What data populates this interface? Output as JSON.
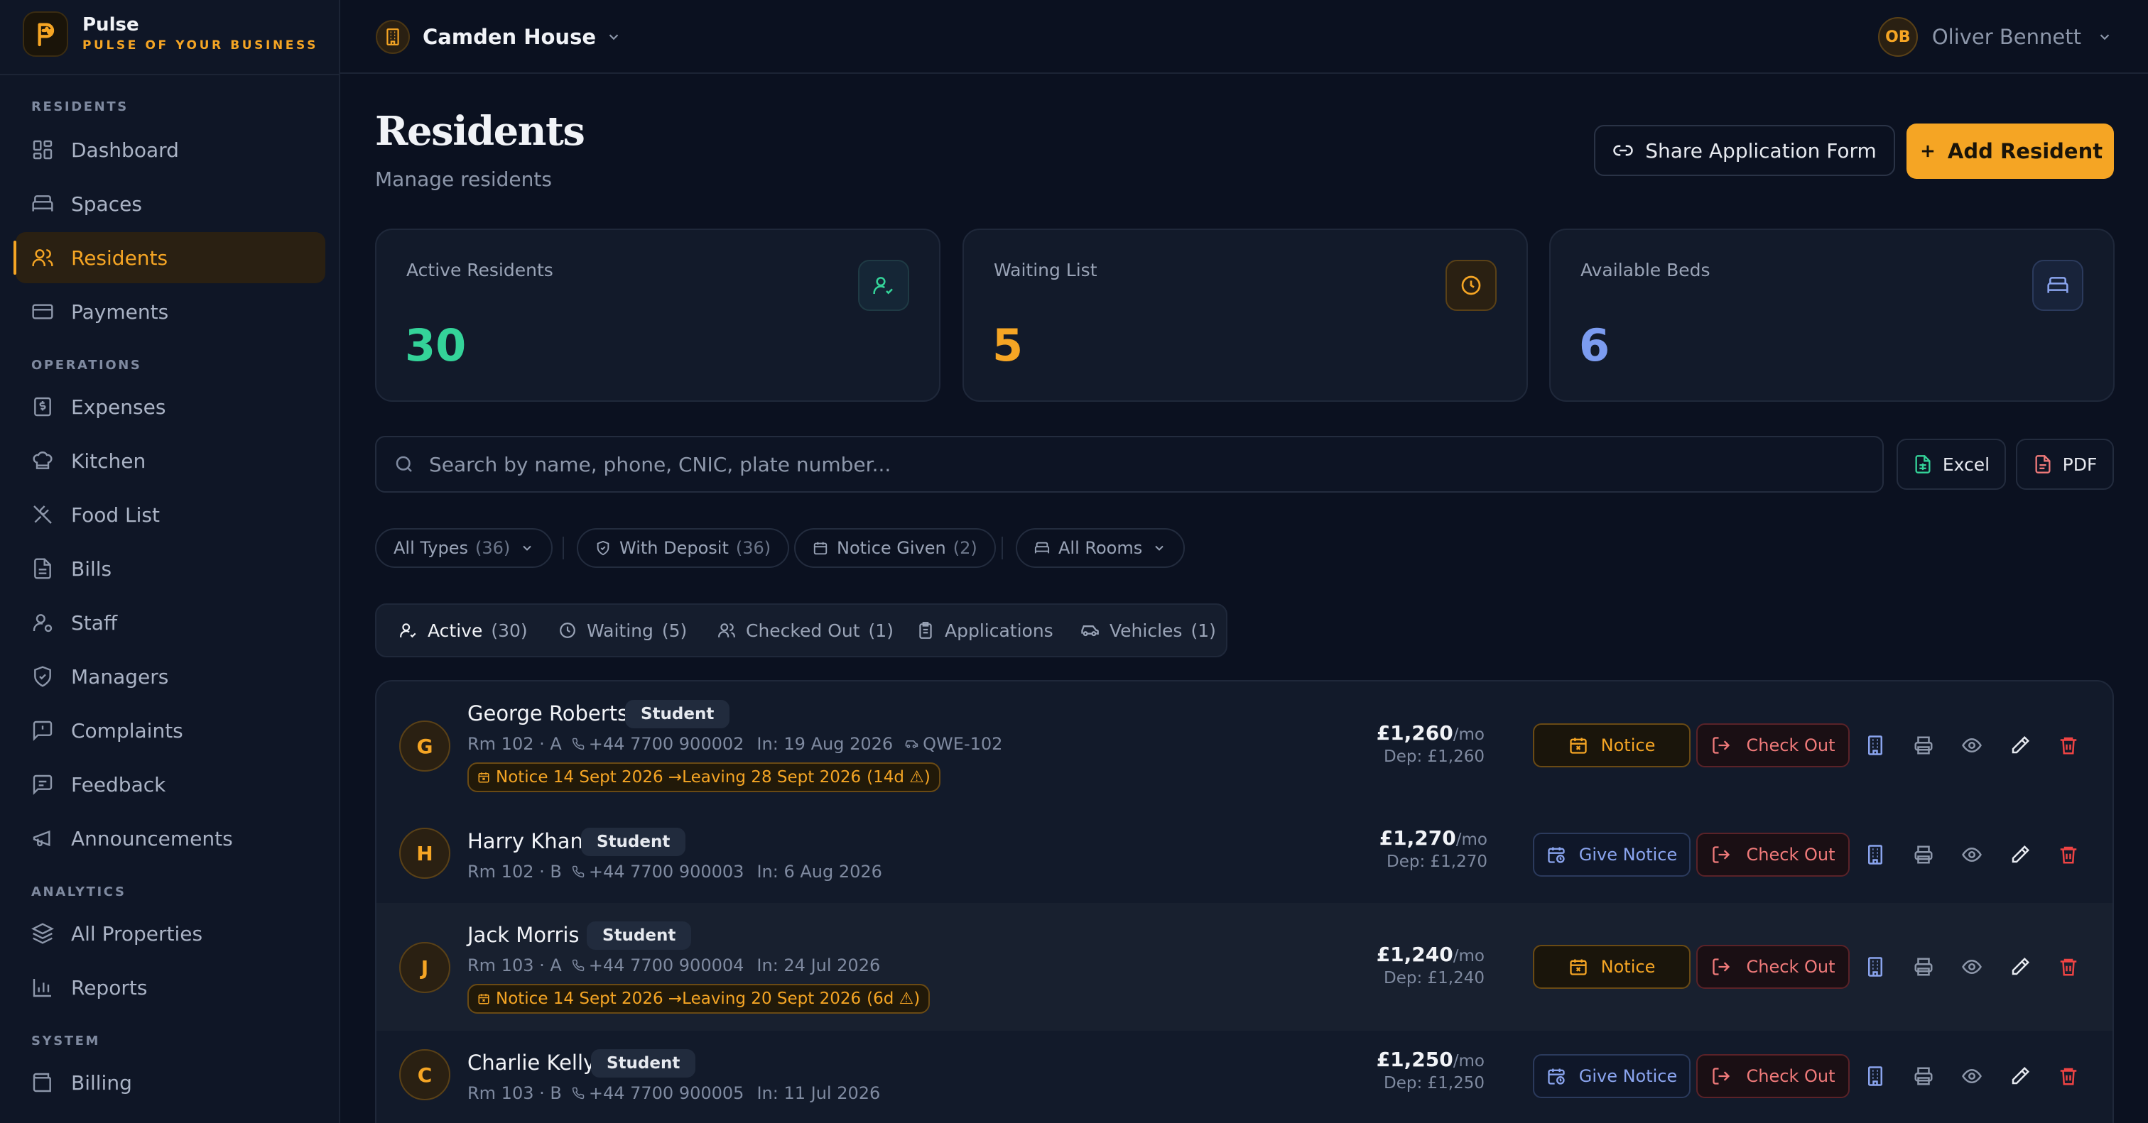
{
  "brand": {
    "name": "Pulse",
    "tagline": "PULSE OF YOUR BUSINESS"
  },
  "sidebar": {
    "sections": [
      {
        "title": "RESIDENTS",
        "items": [
          {
            "label": "Dashboard",
            "icon": "dashboard-icon"
          },
          {
            "label": "Spaces",
            "icon": "bed-icon"
          },
          {
            "label": "Residents",
            "icon": "users-icon",
            "active": true
          },
          {
            "label": "Payments",
            "icon": "card-icon"
          }
        ]
      },
      {
        "title": "OPERATIONS",
        "items": [
          {
            "label": "Expenses",
            "icon": "receipt-icon"
          },
          {
            "label": "Kitchen",
            "icon": "chef-hat-icon"
          },
          {
            "label": "Food List",
            "icon": "utensils-icon"
          },
          {
            "label": "Bills",
            "icon": "file-icon"
          },
          {
            "label": "Staff",
            "icon": "user-cog-icon"
          },
          {
            "label": "Managers",
            "icon": "shield-icon"
          },
          {
            "label": "Complaints",
            "icon": "alert-message-icon"
          },
          {
            "label": "Feedback",
            "icon": "message-icon"
          },
          {
            "label": "Announcements",
            "icon": "megaphone-icon"
          }
        ]
      },
      {
        "title": "ANALYTICS",
        "items": [
          {
            "label": "All Properties",
            "icon": "layers-icon"
          },
          {
            "label": "Reports",
            "icon": "bar-chart-icon"
          }
        ]
      },
      {
        "title": "SYSTEM",
        "items": [
          {
            "label": "Billing",
            "icon": "wallet-icon"
          }
        ]
      }
    ]
  },
  "topbar": {
    "property": "Camden House",
    "user_initials": "OB",
    "user_name": "Oliver Bennett"
  },
  "header": {
    "title": "Residents",
    "subtitle": "Manage residents",
    "share_label": "Share Application Form",
    "add_label": "Add Resident"
  },
  "stats": [
    {
      "label": "Active Residents",
      "value": "30",
      "color": "#34d399",
      "icon": "user-check-icon"
    },
    {
      "label": "Waiting List",
      "value": "5",
      "color": "#f5a524",
      "icon": "clock-icon"
    },
    {
      "label": "Available Beds",
      "value": "6",
      "color": "#7c9cf0",
      "icon": "bed-icon"
    }
  ],
  "search": {
    "placeholder": "Search by name, phone, CNIC, plate number..."
  },
  "exports": {
    "excel": "Excel",
    "pdf": "PDF"
  },
  "filters": [
    {
      "label": "All Types",
      "count": "(36)"
    },
    {
      "label": "With Deposit",
      "count": "(36)"
    },
    {
      "label": "Notice Given",
      "count": "(2)"
    },
    {
      "label": "All Rooms",
      "count": ""
    }
  ],
  "tabs": [
    {
      "label": "Active",
      "count": "(30)"
    },
    {
      "label": "Waiting",
      "count": "(5)"
    },
    {
      "label": "Checked Out",
      "count": "(1)"
    },
    {
      "label": "Applications",
      "count": ""
    },
    {
      "label": "Vehicles",
      "count": "(1)"
    }
  ],
  "residents": [
    {
      "initial": "G",
      "name": "George Roberts",
      "type": "Student",
      "room": "Rm 102 · A",
      "phone": "+44 7700 900002",
      "checkin": "In: 19 Aug 2026",
      "plate": "QWE-102",
      "notice": "Notice 14 Sept 2026 →Leaving 28 Sept 2026",
      "notice_days": "(14d ⚠)",
      "rent": "£1,260",
      "per": "/mo",
      "deposit": "Dep: £1,260",
      "notice_button": "Notice",
      "checkout_button": "Check Out"
    },
    {
      "initial": "H",
      "name": "Harry Khan",
      "type": "Student",
      "room": "Rm 102 · B",
      "phone": "+44 7700 900003",
      "checkin": "In: 6 Aug 2026",
      "plate": "",
      "notice": "",
      "notice_days": "",
      "rent": "£1,270",
      "per": "/mo",
      "deposit": "Dep: £1,270",
      "notice_button": "Give Notice",
      "checkout_button": "Check Out"
    },
    {
      "initial": "J",
      "name": "Jack Morris",
      "type": "Student",
      "room": "Rm 103 · A",
      "phone": "+44 7700 900004",
      "checkin": "In: 24 Jul 2026",
      "plate": "",
      "notice": "Notice 14 Sept 2026 →Leaving 20 Sept 2026",
      "notice_days": "(6d ⚠)",
      "rent": "£1,240",
      "per": "/mo",
      "deposit": "Dep: £1,240",
      "notice_button": "Notice",
      "checkout_button": "Check Out"
    },
    {
      "initial": "C",
      "name": "Charlie Kelly",
      "type": "Student",
      "room": "Rm 103 · B",
      "phone": "+44 7700 900005",
      "checkin": "In: 11 Jul 2026",
      "plate": "",
      "notice": "",
      "notice_days": "",
      "rent": "£1,250",
      "per": "/mo",
      "deposit": "Dep: £1,250",
      "notice_button": "Give Notice",
      "checkout_button": "Check Out"
    }
  ]
}
